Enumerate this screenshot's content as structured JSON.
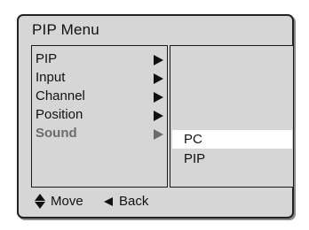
{
  "menu": {
    "title": "PIP Menu",
    "items": [
      {
        "label": "PIP",
        "active": false
      },
      {
        "label": "Input",
        "active": false
      },
      {
        "label": "Channel",
        "active": false
      },
      {
        "label": "Position",
        "active": false
      },
      {
        "label": "Sound",
        "active": true
      }
    ]
  },
  "submenu": {
    "options": [
      {
        "label": "PC",
        "selected": true
      },
      {
        "label": "PIP",
        "selected": false
      }
    ]
  },
  "footer": {
    "move_label": "Move",
    "back_label": "Back"
  },
  "colors": {
    "background": "#d6d6d6",
    "border": "#222222",
    "text": "#111111",
    "active_text": "#6b6b6b",
    "selected_row": "#ffffff"
  },
  "icons": {
    "submenu_arrow": "triangle-right-icon",
    "move": "up-down-arrows-icon",
    "back": "triangle-left-icon"
  }
}
